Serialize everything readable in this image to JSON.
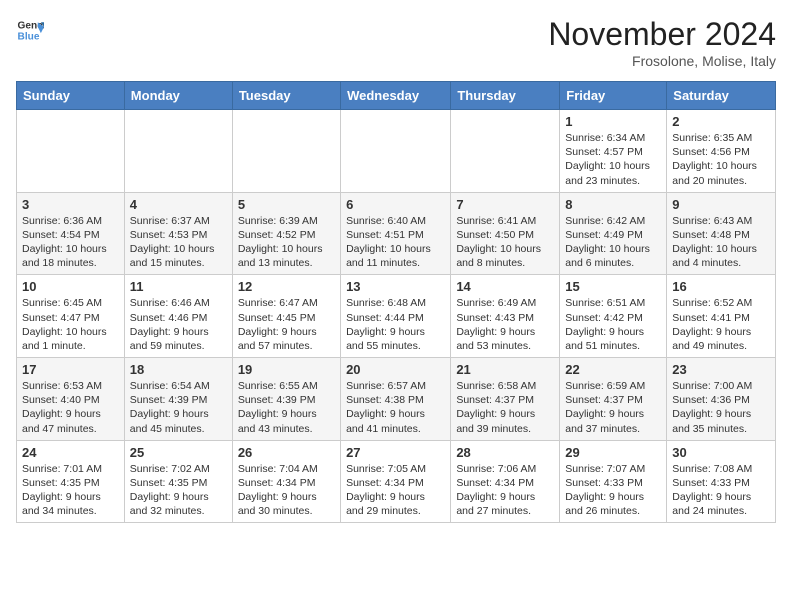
{
  "header": {
    "logo_line1": "General",
    "logo_line2": "Blue",
    "month": "November 2024",
    "location": "Frosolone, Molise, Italy"
  },
  "weekdays": [
    "Sunday",
    "Monday",
    "Tuesday",
    "Wednesday",
    "Thursday",
    "Friday",
    "Saturday"
  ],
  "weeks": [
    [
      {
        "day": "",
        "info": ""
      },
      {
        "day": "",
        "info": ""
      },
      {
        "day": "",
        "info": ""
      },
      {
        "day": "",
        "info": ""
      },
      {
        "day": "",
        "info": ""
      },
      {
        "day": "1",
        "info": "Sunrise: 6:34 AM\nSunset: 4:57 PM\nDaylight: 10 hours\nand 23 minutes."
      },
      {
        "day": "2",
        "info": "Sunrise: 6:35 AM\nSunset: 4:56 PM\nDaylight: 10 hours\nand 20 minutes."
      }
    ],
    [
      {
        "day": "3",
        "info": "Sunrise: 6:36 AM\nSunset: 4:54 PM\nDaylight: 10 hours\nand 18 minutes."
      },
      {
        "day": "4",
        "info": "Sunrise: 6:37 AM\nSunset: 4:53 PM\nDaylight: 10 hours\nand 15 minutes."
      },
      {
        "day": "5",
        "info": "Sunrise: 6:39 AM\nSunset: 4:52 PM\nDaylight: 10 hours\nand 13 minutes."
      },
      {
        "day": "6",
        "info": "Sunrise: 6:40 AM\nSunset: 4:51 PM\nDaylight: 10 hours\nand 11 minutes."
      },
      {
        "day": "7",
        "info": "Sunrise: 6:41 AM\nSunset: 4:50 PM\nDaylight: 10 hours\nand 8 minutes."
      },
      {
        "day": "8",
        "info": "Sunrise: 6:42 AM\nSunset: 4:49 PM\nDaylight: 10 hours\nand 6 minutes."
      },
      {
        "day": "9",
        "info": "Sunrise: 6:43 AM\nSunset: 4:48 PM\nDaylight: 10 hours\nand 4 minutes."
      }
    ],
    [
      {
        "day": "10",
        "info": "Sunrise: 6:45 AM\nSunset: 4:47 PM\nDaylight: 10 hours\nand 1 minute."
      },
      {
        "day": "11",
        "info": "Sunrise: 6:46 AM\nSunset: 4:46 PM\nDaylight: 9 hours\nand 59 minutes."
      },
      {
        "day": "12",
        "info": "Sunrise: 6:47 AM\nSunset: 4:45 PM\nDaylight: 9 hours\nand 57 minutes."
      },
      {
        "day": "13",
        "info": "Sunrise: 6:48 AM\nSunset: 4:44 PM\nDaylight: 9 hours\nand 55 minutes."
      },
      {
        "day": "14",
        "info": "Sunrise: 6:49 AM\nSunset: 4:43 PM\nDaylight: 9 hours\nand 53 minutes."
      },
      {
        "day": "15",
        "info": "Sunrise: 6:51 AM\nSunset: 4:42 PM\nDaylight: 9 hours\nand 51 minutes."
      },
      {
        "day": "16",
        "info": "Sunrise: 6:52 AM\nSunset: 4:41 PM\nDaylight: 9 hours\nand 49 minutes."
      }
    ],
    [
      {
        "day": "17",
        "info": "Sunrise: 6:53 AM\nSunset: 4:40 PM\nDaylight: 9 hours\nand 47 minutes."
      },
      {
        "day": "18",
        "info": "Sunrise: 6:54 AM\nSunset: 4:39 PM\nDaylight: 9 hours\nand 45 minutes."
      },
      {
        "day": "19",
        "info": "Sunrise: 6:55 AM\nSunset: 4:39 PM\nDaylight: 9 hours\nand 43 minutes."
      },
      {
        "day": "20",
        "info": "Sunrise: 6:57 AM\nSunset: 4:38 PM\nDaylight: 9 hours\nand 41 minutes."
      },
      {
        "day": "21",
        "info": "Sunrise: 6:58 AM\nSunset: 4:37 PM\nDaylight: 9 hours\nand 39 minutes."
      },
      {
        "day": "22",
        "info": "Sunrise: 6:59 AM\nSunset: 4:37 PM\nDaylight: 9 hours\nand 37 minutes."
      },
      {
        "day": "23",
        "info": "Sunrise: 7:00 AM\nSunset: 4:36 PM\nDaylight: 9 hours\nand 35 minutes."
      }
    ],
    [
      {
        "day": "24",
        "info": "Sunrise: 7:01 AM\nSunset: 4:35 PM\nDaylight: 9 hours\nand 34 minutes."
      },
      {
        "day": "25",
        "info": "Sunrise: 7:02 AM\nSunset: 4:35 PM\nDaylight: 9 hours\nand 32 minutes."
      },
      {
        "day": "26",
        "info": "Sunrise: 7:04 AM\nSunset: 4:34 PM\nDaylight: 9 hours\nand 30 minutes."
      },
      {
        "day": "27",
        "info": "Sunrise: 7:05 AM\nSunset: 4:34 PM\nDaylight: 9 hours\nand 29 minutes."
      },
      {
        "day": "28",
        "info": "Sunrise: 7:06 AM\nSunset: 4:34 PM\nDaylight: 9 hours\nand 27 minutes."
      },
      {
        "day": "29",
        "info": "Sunrise: 7:07 AM\nSunset: 4:33 PM\nDaylight: 9 hours\nand 26 minutes."
      },
      {
        "day": "30",
        "info": "Sunrise: 7:08 AM\nSunset: 4:33 PM\nDaylight: 9 hours\nand 24 minutes."
      }
    ]
  ]
}
